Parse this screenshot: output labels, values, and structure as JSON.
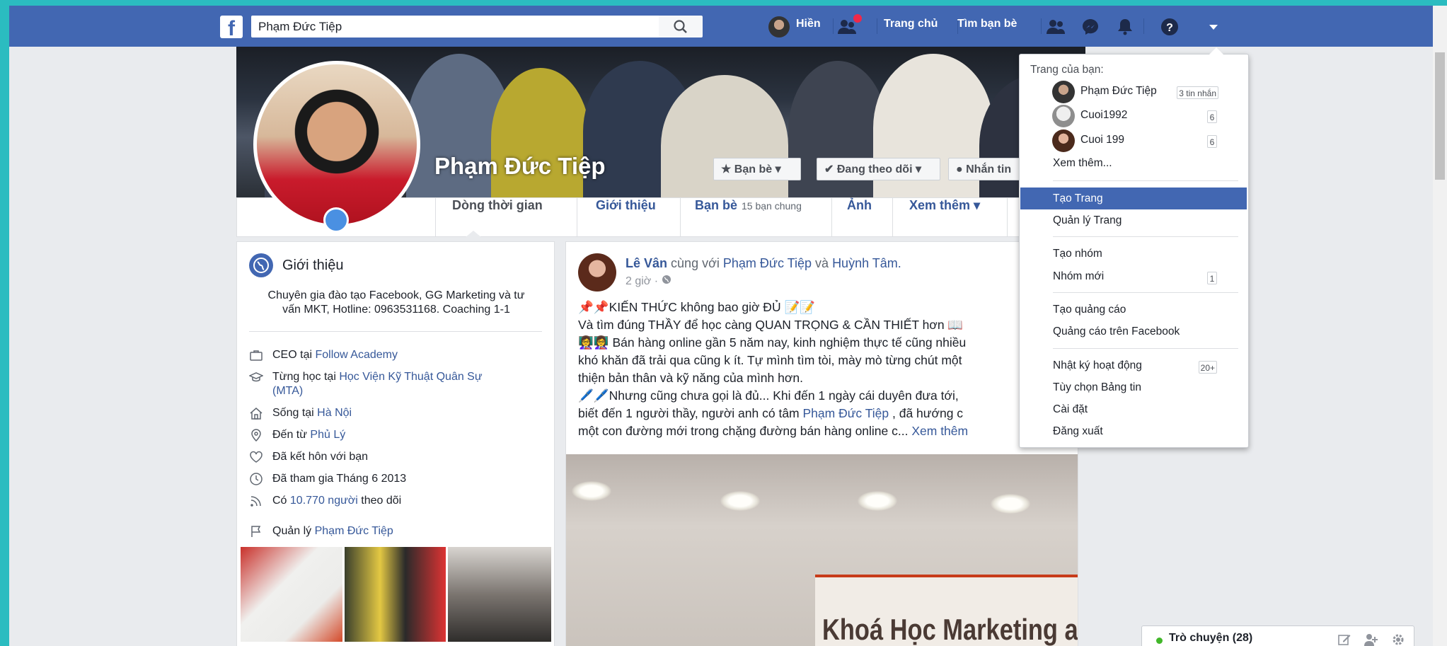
{
  "topbar": {
    "logo": "f",
    "search_value": "Phạm Đức Tiệp",
    "user_name": "Hiền",
    "nav_home": "Trang chủ",
    "nav_find_friends": "Tìm bạn bè"
  },
  "profile": {
    "name": "Phạm Đức Tiệp",
    "btn_friends": "Bạn bè",
    "btn_following": "Đang theo dõi",
    "btn_message": "Nhắn tin",
    "tabs": {
      "timeline": "Dòng thời gian",
      "about": "Giới thiệu",
      "friends": "Bạn bè",
      "friends_mutual": "15 bạn chung",
      "photos": "Ảnh",
      "more": "Xem thêm"
    }
  },
  "intro": {
    "title": "Giới thiệu",
    "bio_line1": "Chuyên gia đào tạo Facebook, GG Marketing và tư",
    "bio_line2": "vấn MKT, Hotline: 0963531168. Coaching 1-1",
    "work_prefix": "CEO tại",
    "work_link": "Follow Academy",
    "study_prefix": "Từng học tại",
    "study_link_1": "Học Viện Kỹ Thuật Quân Sự",
    "study_link_2": "(MTA)",
    "live_prefix": "Sống tại",
    "live_link": "Hà Nội",
    "from_prefix": "Đến từ",
    "from_link": "Phủ Lý",
    "relationship": "Đã kết hôn với bạn",
    "joined": "Đã tham gia Tháng 6 2013",
    "followers_prefix": "Có",
    "followers_link": "10.770 người",
    "followers_suffix": "theo dõi",
    "manage_prefix": "Quản lý",
    "manage_link": "Phạm Đức Tiệp"
  },
  "post": {
    "author": "Lê Vân",
    "with_text": "cùng với",
    "tag1": "Phạm Đức Tiệp",
    "and_text": "và",
    "tag2": "Huỳnh Tâm.",
    "time": "2 giờ ·",
    "line1": "📌📌KIẾN THỨC không bao giờ ĐỦ 📝📝",
    "line2": "Và tìm đúng THẦY để học càng QUAN TRỌNG & CẦN THIẾT hơn 📖",
    "line3": "👩‍🏫👩‍🏫 Bán hàng online gần 5 năm nay, kinh nghiệm thực tế cũng nhiều",
    "line4": "khó khăn đã trải qua cũng k ít. Tự mình tìm tòi, mày mò từng chút một",
    "line5": "thiện bản thân và kỹ năng của mình hơn.",
    "line6": "🖊️🖊️Nhưng cũng chưa gọi là đủ... Khi đến 1 ngày cái duyên đưa tới,",
    "line7_a": "biết đến 1 người thầy, người anh có tâm",
    "line7_link": "Phạm Đức Tiệp",
    "line7_b": ", đã hướng c",
    "line8": "một con đường mới trong chặng đường bán hàng online c...",
    "see_more": "Xem thêm",
    "image_banner": "Khoá Học Marketing auto"
  },
  "dropdown": {
    "header": "Trang của bạn:",
    "pages": [
      {
        "name": "Phạm Đức Tiệp",
        "badge": "3 tin nhắn"
      },
      {
        "name": "Cuoi1992",
        "badge": "6"
      },
      {
        "name": "Cuoi 199",
        "badge": "6"
      }
    ],
    "see_more": "Xem thêm...",
    "create_page": "Tạo Trang",
    "manage_pages": "Quản lý Trang",
    "create_group": "Tạo nhóm",
    "new_groups": "Nhóm mới",
    "new_groups_badge": "1",
    "create_ad": "Tạo quảng cáo",
    "ads_on_fb": "Quảng cáo trên Facebook",
    "activity_log": "Nhật ký hoạt động",
    "activity_badge": "20+",
    "news_feed_prefs": "Tùy chọn Bảng tin",
    "settings": "Cài đặt",
    "logout": "Đăng xuất"
  },
  "chat": {
    "label": "Trò chuyện (28)"
  },
  "colors": {
    "brand": "#4267b2",
    "link": "#365899",
    "background": "#e9ebee",
    "online": "#42b72a"
  }
}
